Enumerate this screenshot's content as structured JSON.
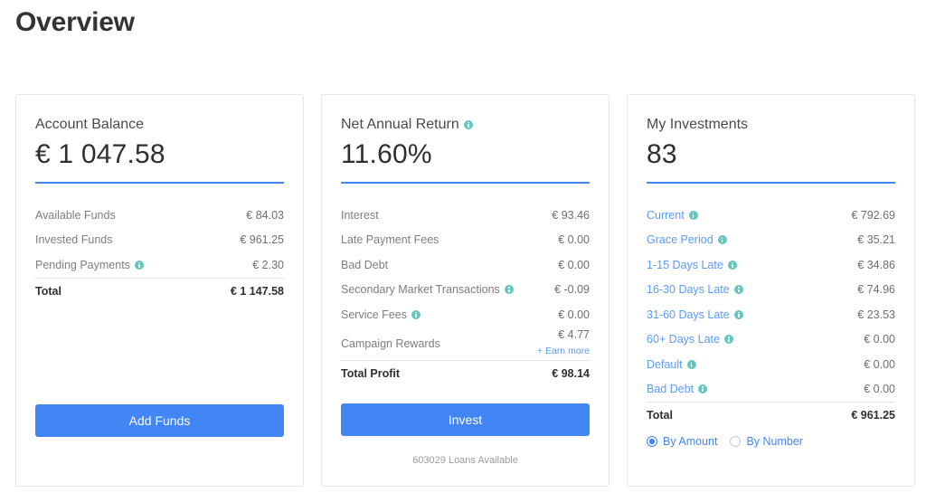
{
  "page": {
    "title": "Overview"
  },
  "colors": {
    "accent_blue": "#4285f4",
    "link_blue": "#5b9bf8",
    "info_teal": "#63c6c0",
    "card_border": "#e6e6e6",
    "text_dark": "#2f2f2f",
    "text_muted": "#7d7d7d"
  },
  "cards": {
    "account_balance": {
      "label": "Account Balance",
      "value": "€ 1 047.58",
      "rows": [
        {
          "label": "Available Funds",
          "value": "€ 84.03",
          "info": false
        },
        {
          "label": "Invested Funds",
          "value": "€ 961.25",
          "info": false
        },
        {
          "label": "Pending Payments",
          "value": "€ 2.30",
          "info": true
        }
      ],
      "total": {
        "label": "Total",
        "value": "€ 1 147.58"
      },
      "button": "Add Funds"
    },
    "net_annual_return": {
      "label": "Net Annual Return",
      "label_info": true,
      "value": "11.60%",
      "rows": [
        {
          "label": "Interest",
          "value": "€ 93.46",
          "info": false
        },
        {
          "label": "Late Payment Fees",
          "value": "€ 0.00",
          "info": false
        },
        {
          "label": "Bad Debt",
          "value": "€ 0.00",
          "info": false
        },
        {
          "label": "Secondary Market Transactions",
          "value": "€ -0.09",
          "info": true
        },
        {
          "label": "Service Fees",
          "value": "€ 0.00",
          "info": true
        }
      ],
      "campaign": {
        "label": "Campaign Rewards",
        "value": "€ 4.77",
        "link": "+ Earn more"
      },
      "total": {
        "label": "Total Profit",
        "value": "€ 98.14"
      },
      "button": "Invest",
      "note": "603029 Loans Available"
    },
    "my_investments": {
      "label": "My Investments",
      "value": "83",
      "rows": [
        {
          "label": "Current",
          "value": "€ 792.69",
          "info": true
        },
        {
          "label": "Grace Period",
          "value": "€ 35.21",
          "info": true
        },
        {
          "label": "1-15 Days Late",
          "value": "€ 34.86",
          "info": true
        },
        {
          "label": "16-30 Days Late",
          "value": "€ 74.96",
          "info": true
        },
        {
          "label": "31-60 Days Late",
          "value": "€ 23.53",
          "info": true
        },
        {
          "label": "60+ Days Late",
          "value": "€ 0.00",
          "info": true
        },
        {
          "label": "Default",
          "value": "€ 0.00",
          "info": true
        },
        {
          "label": "Bad Debt",
          "value": "€ 0.00",
          "info": true
        }
      ],
      "total": {
        "label": "Total",
        "value": "€ 961.25"
      },
      "radios": [
        {
          "label": "By Amount",
          "selected": true
        },
        {
          "label": "By Number",
          "selected": false
        }
      ]
    }
  }
}
